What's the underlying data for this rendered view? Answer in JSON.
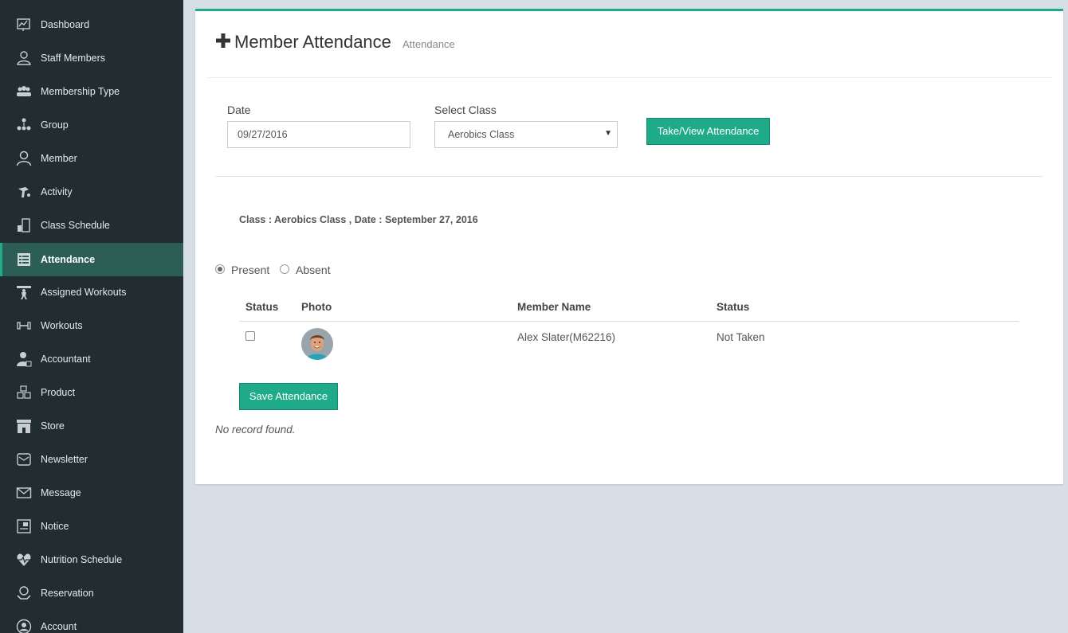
{
  "sidebar": {
    "items": [
      {
        "label": "Dashboard",
        "icon": "dashboard-icon",
        "active": false
      },
      {
        "label": "Staff Members",
        "icon": "staff-members-icon",
        "active": false
      },
      {
        "label": "Membership Type",
        "icon": "membership-type-icon",
        "active": false
      },
      {
        "label": "Group",
        "icon": "group-icon",
        "active": false
      },
      {
        "label": "Member",
        "icon": "member-icon",
        "active": false
      },
      {
        "label": "Activity",
        "icon": "activity-icon",
        "active": false
      },
      {
        "label": "Class Schedule",
        "icon": "class-schedule-icon",
        "active": false
      },
      {
        "label": "Attendance",
        "icon": "attendance-icon",
        "active": true
      },
      {
        "label": "Assigned Workouts",
        "icon": "assigned-workouts-icon",
        "active": false
      },
      {
        "label": "Workouts",
        "icon": "workouts-icon",
        "active": false
      },
      {
        "label": "Accountant",
        "icon": "accountant-icon",
        "active": false
      },
      {
        "label": "Product",
        "icon": "product-icon",
        "active": false
      },
      {
        "label": "Store",
        "icon": "store-icon",
        "active": false
      },
      {
        "label": "Newsletter",
        "icon": "newsletter-icon",
        "active": false
      },
      {
        "label": "Message",
        "icon": "message-icon",
        "active": false
      },
      {
        "label": "Notice",
        "icon": "notice-icon",
        "active": false
      },
      {
        "label": "Nutrition Schedule",
        "icon": "nutrition-schedule-icon",
        "active": false
      },
      {
        "label": "Reservation",
        "icon": "reservation-icon",
        "active": false
      },
      {
        "label": "Account",
        "icon": "account-icon",
        "active": false
      }
    ]
  },
  "header": {
    "title": "Member Attendance",
    "subtitle": "Attendance",
    "icon": "plus-icon"
  },
  "form": {
    "date_label": "Date",
    "date_value": "09/27/2016",
    "class_label": "Select Class",
    "class_value": "Aerobics Class",
    "submit_label": "Take/View Attendance"
  },
  "class_info": "Class : Aerobics Class , Date : September 27, 2016",
  "attendance_options": {
    "present_label": "Present",
    "absent_label": "Absent",
    "selected": "Present"
  },
  "table": {
    "headers": [
      "Status",
      "Photo",
      "Member Name",
      "Status"
    ],
    "rows": [
      {
        "checked": false,
        "member_name": "Alex Slater(M62216)",
        "status": "Not Taken"
      }
    ]
  },
  "save_label": "Save Attendance",
  "no_record": "No record found.",
  "colors": {
    "accent": "#1fab89",
    "sidebar_bg": "#222d32",
    "sidebar_active": "#2c5e55",
    "page_bg": "#d8dee6"
  }
}
